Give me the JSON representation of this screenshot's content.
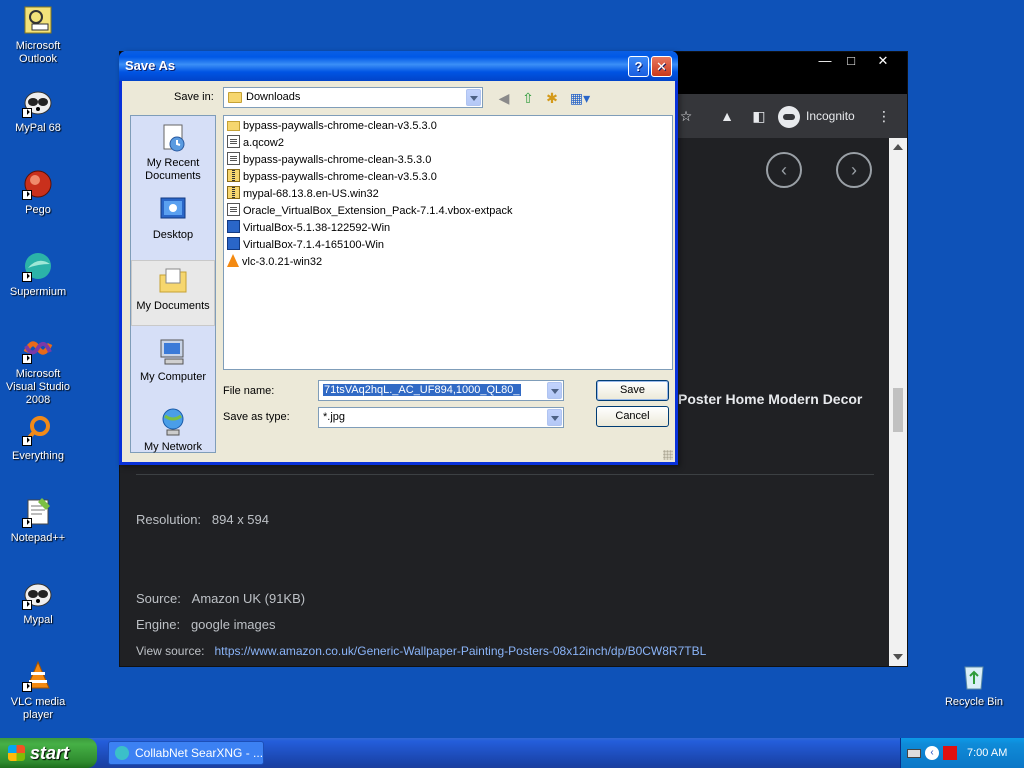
{
  "desktop": {
    "icons": [
      {
        "label": "Microsoft Outlook",
        "icon": "outlook-icon"
      },
      {
        "label": "MyPal 68",
        "icon": "mypal-icon"
      },
      {
        "label": "Pego",
        "icon": "pego-icon"
      },
      {
        "label": "Supermium",
        "icon": "supermium-icon"
      },
      {
        "label": "Microsoft Visual Studio 2008",
        "icon": "visual-studio-icon"
      },
      {
        "label": "Everything",
        "icon": "everything-icon"
      },
      {
        "label": "Notepad++",
        "icon": "notepadpp-icon"
      },
      {
        "label": "Mypal",
        "icon": "mypal-icon"
      },
      {
        "label": "VLC media player",
        "icon": "vlc-icon"
      },
      {
        "label": "Recycle Bin",
        "icon": "recycle-bin-icon"
      }
    ]
  },
  "browser": {
    "incognito_label": "Incognito",
    "poster_title": "Poster Home Modern Decor",
    "resolution_label": "Resolution:",
    "resolution_value": "894 x 594",
    "source_label": "Source:",
    "source_value": "Amazon UK (91KB)",
    "engine_label": "Engine:",
    "engine_value": "google images",
    "view_source_label": "View source:",
    "view_source_url": "https://www.amazon.co.uk/Generic-Wallpaper-Painting-Posters-08x12inch/dp/B0CW8R7TBL"
  },
  "dialog": {
    "title": "Save As",
    "save_in_label": "Save in:",
    "save_in_value": "Downloads",
    "places": [
      {
        "label": "My Recent Documents",
        "icon": "recent-documents-icon"
      },
      {
        "label": "Desktop",
        "icon": "desktop-icon"
      },
      {
        "label": "My Documents",
        "icon": "my-documents-icon"
      },
      {
        "label": "My Computer",
        "icon": "my-computer-icon"
      },
      {
        "label": "My Network",
        "icon": "my-network-icon"
      }
    ],
    "files": [
      {
        "name": "bypass-paywalls-chrome-clean-v3.5.3.0",
        "type": "folder"
      },
      {
        "name": "a.qcow2",
        "type": "file"
      },
      {
        "name": "bypass-paywalls-chrome-clean-3.5.3.0",
        "type": "file"
      },
      {
        "name": "bypass-paywalls-chrome-clean-v3.5.3.0",
        "type": "zip"
      },
      {
        "name": "mypal-68.13.8.en-US.win32",
        "type": "zip"
      },
      {
        "name": "Oracle_VirtualBox_Extension_Pack-7.1.4.vbox-extpack",
        "type": "file"
      },
      {
        "name": "VirtualBox-5.1.38-122592-Win",
        "type": "vbox"
      },
      {
        "name": "VirtualBox-7.1.4-165100-Win",
        "type": "vbox"
      },
      {
        "name": "vlc-3.0.21-win32",
        "type": "vlc"
      }
    ],
    "file_name_label": "File name:",
    "file_name_value": "71tsVAq2hqL._AC_UF894,1000_QL80_",
    "save_type_label": "Save as type:",
    "save_type_value": "*.jpg",
    "save_button": "Save",
    "cancel_button": "Cancel",
    "help_button": "?",
    "close_button": "✕"
  },
  "taskbar": {
    "start_label": "start",
    "task_item": "CollabNet SearXNG - ...",
    "clock": "7:00 AM"
  }
}
